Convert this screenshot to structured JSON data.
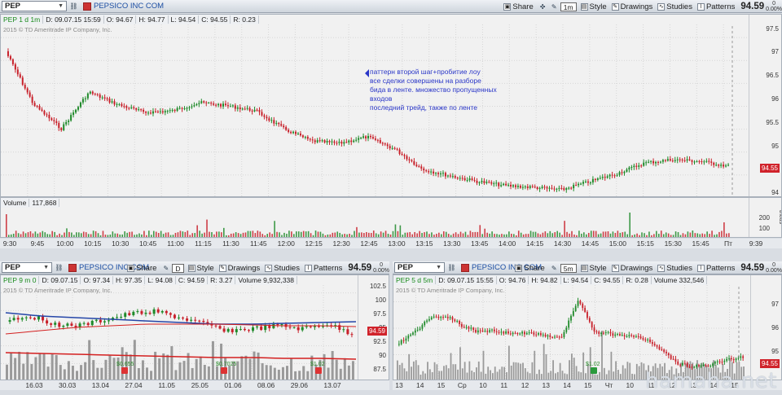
{
  "top": {
    "symbol": "PEP",
    "company": "PEPSICO INC COM",
    "buttons": {
      "share": "Share",
      "period": "1m",
      "style": "Style",
      "drawings": "Drawings",
      "studies": "Studies",
      "patterns": "Patterns"
    },
    "last_price": "94.59",
    "change_top": "0",
    "change_pct": "0.00%",
    "info": {
      "label": "PEP 1 d 1m",
      "date": "D: 09.07.15 15:59",
      "open": "O: 94.67",
      "high": "H: 94.77",
      "low": "L: 94.54",
      "close": "C: 94.55",
      "range": "R: 0.23"
    },
    "copyright": "2015 © TD Ameritrade IP Company, Inc.",
    "y_ticks": [
      "97.5",
      "97",
      "96.5",
      "96",
      "95.5",
      "95",
      "94.5",
      "94"
    ],
    "price_tag": "94.55",
    "annotation": [
      "паттерн второй шаг+пробитие лоу",
      "все сделки совершены на разборе",
      "бида в ленте. множество пропущенных",
      "входов",
      "последний трейд, также по ленте"
    ],
    "volume_label": "Volume",
    "volume_value": "117,868",
    "vol_ticks": [
      "200",
      "100"
    ],
    "vol_axis_unit": "thous",
    "x_ticks": [
      "9:30",
      "9:45",
      "10:00",
      "10:15",
      "10:30",
      "10:45",
      "11:00",
      "11:15",
      "11:30",
      "11:45",
      "12:00",
      "12:15",
      "12:30",
      "12:45",
      "13:00",
      "13:15",
      "13:30",
      "13:45",
      "14:00",
      "14:15",
      "14:30",
      "14:45",
      "15:00",
      "15:15",
      "15:30",
      "15:45",
      "Пт",
      "9:39"
    ]
  },
  "left": {
    "symbol": "PEP",
    "company": "PEPSICO INC COM",
    "buttons": {
      "share": "Share",
      "period": "D",
      "style": "Style",
      "drawings": "Drawings",
      "studies": "Studies",
      "patterns": "Patterns"
    },
    "last_price": "94.59",
    "change_top": "0",
    "change_pct": "0.00%",
    "info": {
      "label": "PEP 9 m 0",
      "date": "D: 09.07.15",
      "open": "O: 97.34",
      "high": "H: 97.35",
      "low": "L: 94.08",
      "close": "C: 94.59",
      "range": "R: 3.27",
      "volume": "Volume 9,932,338"
    },
    "copyright": "2015 © TD Ameritrade IP Company, Inc.",
    "y_ticks": [
      "102.5",
      "100",
      "97.5",
      "95",
      "92.5",
      "90",
      "87.5"
    ],
    "price_tag": "94.59",
    "x_ticks": [
      "16.03",
      "30.03",
      "13.04",
      "27.04",
      "11.05",
      "25.05",
      "01.06",
      "08.06",
      "29.06",
      "13.07"
    ],
    "events": [
      "$0.655",
      "$0.7025",
      "$1.02"
    ]
  },
  "right": {
    "symbol": "PEP",
    "company": "PEPSICO INC COM",
    "buttons": {
      "share": "Share",
      "period": "5m",
      "style": "Style",
      "drawings": "Drawings",
      "studies": "Studies",
      "patterns": "Patterns"
    },
    "last_price": "94.59",
    "change_top": "0",
    "change_pct": "0.00%",
    "info": {
      "label": "PEP 5 d 5m",
      "date": "D: 09.07.15 15:55",
      "open": "O: 94.76",
      "high": "H: 94.82",
      "low": "L: 94.54",
      "close": "C: 94.55",
      "range": "R: 0.28",
      "volume": "Volume 332,546"
    },
    "copyright": "2015 © TD Ameritrade IP Company, Inc.",
    "y_ticks": [
      "97",
      "96",
      "95"
    ],
    "price_tag": "94.55",
    "x_ticks": [
      "13",
      "14",
      "15",
      "Ср",
      "10",
      "11",
      "12",
      "13",
      "14",
      "15",
      "Чт",
      "10",
      "11",
      "12",
      "13",
      "14",
      "15"
    ],
    "events": [
      "$1.02"
    ]
  },
  "watermark": "hamaha.net",
  "colors": {
    "up": "#1f8a2a",
    "down": "#c8202a",
    "ma_blue": "#2546a8",
    "ma_red": "#d42020",
    "volume": "#9a9a9a",
    "accent": "#d0232b"
  }
}
